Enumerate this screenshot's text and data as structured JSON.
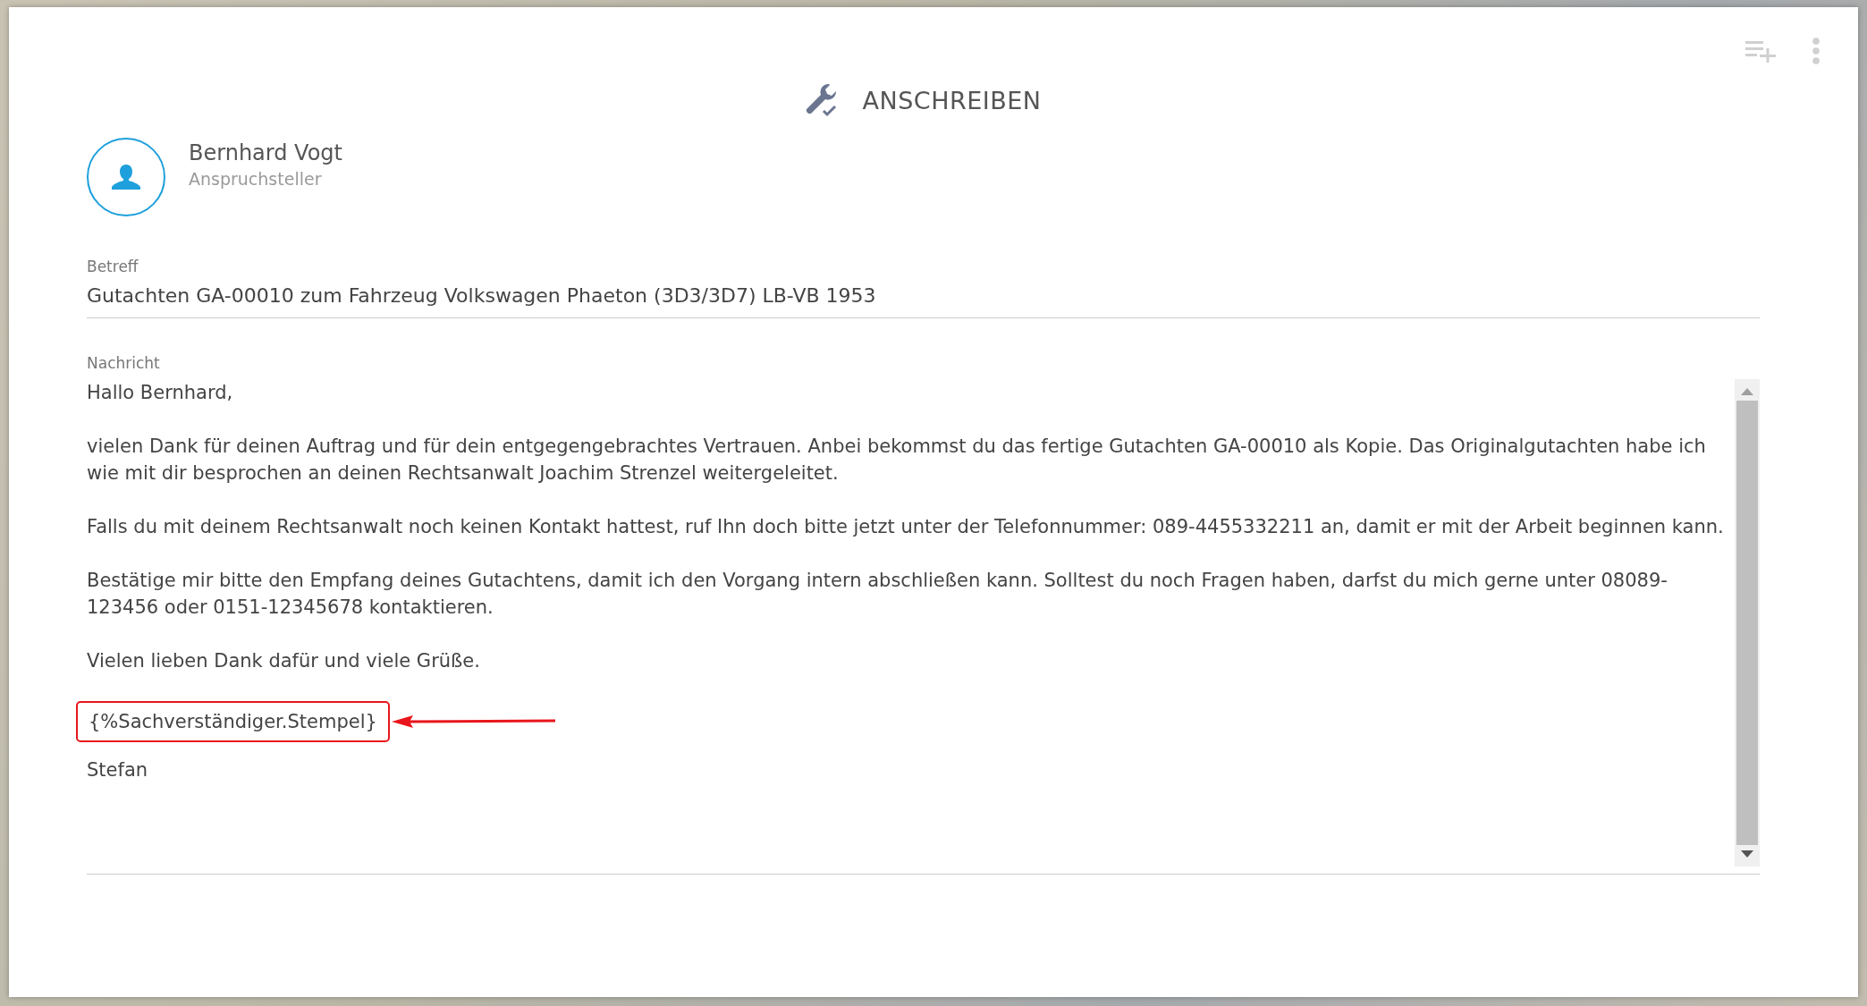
{
  "header": {
    "title": "ANSCHREIBEN"
  },
  "recipient": {
    "name": "Bernhard Vogt",
    "role": "Anspruchsteller"
  },
  "subject": {
    "label": "Betreff",
    "value": "Gutachten GA-00010 zum Fahrzeug Volkswagen Phaeton (3D3/3D7) LB-VB 1953"
  },
  "message": {
    "label": "Nachricht",
    "paragraphs": [
      {
        "kind": "text",
        "text": "Hallo Bernhard,"
      },
      {
        "kind": "text",
        "text": "vielen Dank für deinen Auftrag und für dein entgegengebrachtes Vertrauen. Anbei bekommst du das fertige Gutachten GA-00010 als Kopie. Das Originalgutachten habe ich wie mit dir besprochen an deinen Rechtsanwalt Joachim Strenzel weitergeleitet."
      },
      {
        "kind": "text",
        "text": "Falls du mit deinem Rechtsanwalt noch keinen Kontakt hattest, ruf Ihn doch bitte jetzt unter der Telefonnummer: 089-4455332211 an, damit er mit der Arbeit beginnen kann."
      },
      {
        "kind": "text",
        "text": "Bestätige mir bitte den Empfang deines Gutachtens, damit ich den Vorgang intern abschließen kann. Solltest du noch Fragen haben, darfst du mich gerne unter 08089-123456 oder 0151-12345678 kontaktieren."
      },
      {
        "kind": "text",
        "text": "Vielen lieben Dank dafür und viele Grüße."
      },
      {
        "kind": "highlighted",
        "text": "{%Sachverständiger.Stempel}"
      },
      {
        "kind": "text",
        "text": "Stefan"
      }
    ]
  }
}
